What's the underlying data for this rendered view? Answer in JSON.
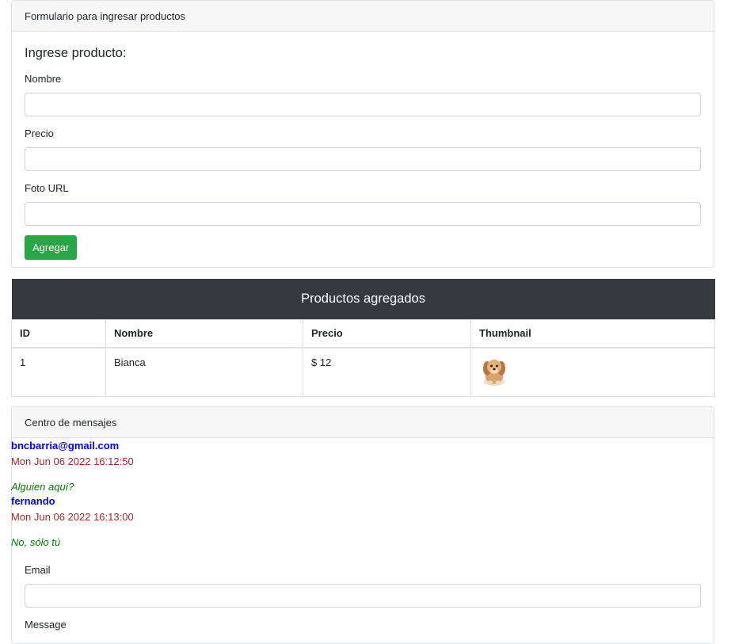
{
  "product_form": {
    "header": "Formulario para ingresar productos",
    "title": "Ingrese producto:",
    "name_label": "Nombre",
    "name_value": "",
    "price_label": "Precio",
    "price_value": "",
    "photo_label": "Foto URL",
    "photo_value": "",
    "submit_label": "Agregar"
  },
  "products": {
    "caption": "Productos agregados",
    "columns": [
      "ID",
      "Nombre",
      "Precio",
      "Thumbnail"
    ],
    "rows": [
      {
        "id": "1",
        "name": "Bianca",
        "price": "$ 12",
        "thumbnail_icon": "dog-photo"
      }
    ]
  },
  "messages": {
    "header": "Centro de mensajes",
    "items": [
      {
        "author": "bncbarria@gmail.com",
        "date": "Mon Jun 06 2022 16:12:50",
        "text": "Alguien aquí?"
      },
      {
        "author": "fernando",
        "date": "Mon Jun 06 2022 16:13:00",
        "text": "No, sólo tú"
      }
    ],
    "email_label": "Email",
    "email_value": "",
    "message_label": "Message"
  },
  "colors": {
    "accent_green": "#28a745",
    "table_header_dark": "#343a40",
    "author_blue": "#0000ff",
    "date_brown": "#a52a2a",
    "message_green": "#008000"
  }
}
